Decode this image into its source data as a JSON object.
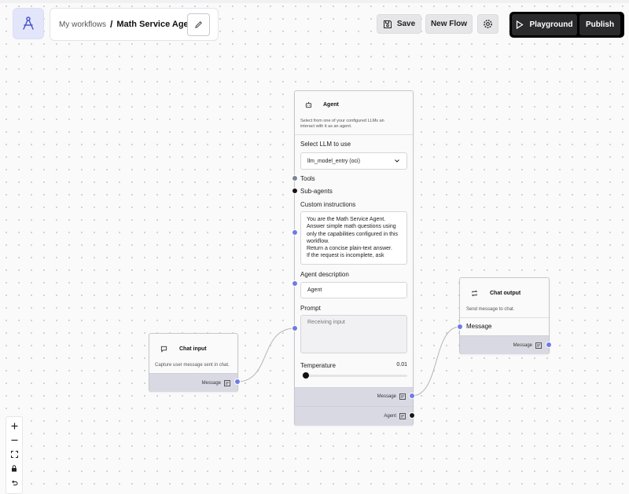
{
  "header": {
    "breadcrumb_root": "My workflows",
    "separator": "/",
    "workflow_title": "Math Service Agent",
    "save_label": "Save",
    "new_flow_label": "New Flow",
    "playground_label": "Playground",
    "publish_label": "Publish"
  },
  "nodes": {
    "agent": {
      "title": "Agent",
      "description": "Select from one of your configured LLMs an interact with it as an agent.",
      "select_llm_label": "Select LLM to use",
      "llm_value": "llm_model_entry (oci)",
      "tools_label": "Tools",
      "subagents_label": "Sub-agents",
      "custom_instructions_label": "Custom instructions",
      "custom_instructions_value": "You are the Math Service Agent.\nAnswer simple math questions using only the capabilities configured in this workflow.\nReturn a concise plain-text answer.\nIf the request is incomplete, ask",
      "agent_description_label": "Agent description",
      "agent_description_value": "Agent",
      "prompt_label": "Prompt",
      "prompt_placeholder": "Receiving input",
      "temperature_label": "Temperature",
      "temperature_value": "0.01",
      "temperature_fraction": 0.01,
      "output_message_label": "Message",
      "output_agent_label": "Agent"
    },
    "chat_input": {
      "title": "Chat input",
      "description": "Capture user message sent in chat.",
      "output_label": "Message"
    },
    "chat_output": {
      "title": "Chat output",
      "description": "Send message to chat.",
      "input_label": "Message",
      "output_label": "Message"
    }
  },
  "colors": {
    "handle_blue": "#6e7be6",
    "handle_black": "#151515",
    "handle_gray": "#7b8496",
    "output_bar": "#d9d9e3",
    "logo_bg": "#e3e6fb"
  },
  "icons": {
    "logo": "compass-logo-icon",
    "edit": "pencil-icon",
    "save": "floppy-disk-icon",
    "settings": "gear-icon",
    "play": "play-icon",
    "agent": "robot-icon",
    "chat_input": "chat-bubble-icon",
    "chat_output": "chat-repeat-icon",
    "inspect": "inspect-icon",
    "zoom_in": "plus-icon",
    "zoom_out": "minus-icon",
    "fit": "fit-view-icon",
    "lock": "lock-icon",
    "undo": "undo-icon"
  }
}
